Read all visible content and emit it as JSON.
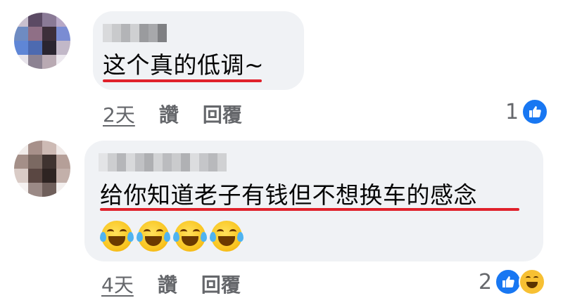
{
  "comments": [
    {
      "text": "这个真的低调~",
      "time": "2天",
      "like_label": "讚",
      "reply_label": "回覆",
      "reaction_count": "1",
      "reactions": [
        "like-icon"
      ],
      "emojis": []
    },
    {
      "text": "给你知道老子有钱但不想换车的感念",
      "time": "4天",
      "like_label": "讚",
      "reply_label": "回覆",
      "reaction_count": "2",
      "reactions": [
        "like-icon",
        "haha-icon"
      ],
      "emojis": [
        "face-with-tears-of-joy",
        "face-with-tears-of-joy",
        "face-with-tears-of-joy",
        "face-with-tears-of-joy"
      ]
    }
  ],
  "colors": {
    "bubble": "#f0f2f5",
    "underline": "#e0212b",
    "meta_text": "#65676b",
    "like_blue": "#1877f2"
  }
}
